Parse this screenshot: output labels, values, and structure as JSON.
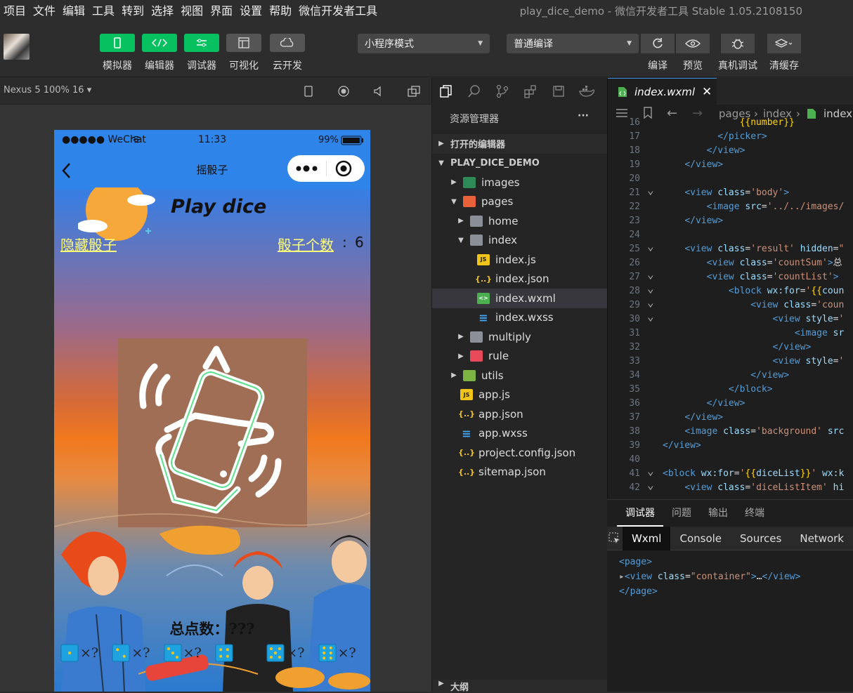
{
  "menu": [
    "项目",
    "文件",
    "编辑",
    "工具",
    "转到",
    "选择",
    "视图",
    "界面",
    "设置",
    "帮助",
    "微信开发者工具"
  ],
  "window_title": "play_dice_demo - 微信开发者工具 Stable 1.05.2108150",
  "toolbar": {
    "buttons": [
      "模拟器",
      "编辑器",
      "调试器",
      "可视化",
      "云开发"
    ],
    "mode_select": "小程序模式",
    "compile_select": "普通编译",
    "right_buttons": [
      "编译",
      "预览",
      "真机调试",
      "清缓存"
    ]
  },
  "simulator": {
    "device": "Nexus 5 100% 16 ▾",
    "status": {
      "carrier": "●●●●● WeChat",
      "time": "11:33",
      "battery": "99%"
    },
    "nav_title": "摇骰子",
    "app": {
      "title": "Play dice",
      "hide_link": "隐藏骰子",
      "count_link": "骰子个数",
      "count_sep": ":",
      "count_value": "6",
      "total": "总点数：???",
      "dice": [
        "×?",
        "×?",
        "×?",
        "×?",
        "×?",
        "×?"
      ]
    }
  },
  "explorer": {
    "title": "资源管理器",
    "more": "···",
    "sections": {
      "open_editors": "打开的编辑器",
      "project": "PLAY_DICE_DEMO",
      "outline": "大纲"
    },
    "tree": [
      {
        "label": "images",
        "depth": 1,
        "arrow": "▶",
        "kind": "folder-img"
      },
      {
        "label": "pages",
        "depth": 1,
        "arrow": "▼",
        "kind": "folder-pages"
      },
      {
        "label": "home",
        "depth": 2,
        "arrow": "▶",
        "kind": "folder"
      },
      {
        "label": "index",
        "depth": 2,
        "arrow": "▼",
        "kind": "folder-open"
      },
      {
        "label": "index.js",
        "depth": 3,
        "arrow": "",
        "kind": "js"
      },
      {
        "label": "index.json",
        "depth": 3,
        "arrow": "",
        "kind": "json"
      },
      {
        "label": "index.wxml",
        "depth": 3,
        "arrow": "",
        "kind": "wxml"
      },
      {
        "label": "index.wxss",
        "depth": 3,
        "arrow": "",
        "kind": "wxss"
      },
      {
        "label": "multiply",
        "depth": 2,
        "arrow": "▶",
        "kind": "folder"
      },
      {
        "label": "rule",
        "depth": 2,
        "arrow": "▶",
        "kind": "folder-rule"
      },
      {
        "label": "utils",
        "depth": 1,
        "arrow": "▶",
        "kind": "folder-utils"
      },
      {
        "label": "app.js",
        "depth": 1,
        "arrow": "",
        "kind": "js"
      },
      {
        "label": "app.json",
        "depth": 1,
        "arrow": "",
        "kind": "json"
      },
      {
        "label": "app.wxss",
        "depth": 1,
        "arrow": "",
        "kind": "wxss"
      },
      {
        "label": "project.config.json",
        "depth": 1,
        "arrow": "",
        "kind": "json"
      },
      {
        "label": "sitemap.json",
        "depth": 1,
        "arrow": "",
        "kind": "json"
      }
    ]
  },
  "editor": {
    "tab": "index.wxml",
    "breadcrumb": [
      "pages",
      "index",
      "index."
    ],
    "lines": [
      {
        "n": "16",
        "fold": "",
        "html": "              <span class='br'>{{number}}</span>"
      },
      {
        "n": "17",
        "fold": "",
        "html": "          <span class='tg'>&lt;/picker&gt;</span>"
      },
      {
        "n": "18",
        "fold": "",
        "html": "        <span class='tg'>&lt;/view&gt;</span>"
      },
      {
        "n": "19",
        "fold": "",
        "html": "    <span class='tg'>&lt;/view&gt;</span>"
      },
      {
        "n": "20",
        "fold": "",
        "html": ""
      },
      {
        "n": "21",
        "fold": "v",
        "html": "    <span class='tg'>&lt;view</span> <span class='at'>class</span>=<span class='st'>'body'</span><span class='tg'>&gt;</span>"
      },
      {
        "n": "22",
        "fold": "",
        "html": "        <span class='tg'>&lt;image</span> <span class='at'>src</span>=<span class='st'>'../../images/</span>"
      },
      {
        "n": "23",
        "fold": "",
        "html": "    <span class='tg'>&lt;/view&gt;</span>"
      },
      {
        "n": "24",
        "fold": "",
        "html": ""
      },
      {
        "n": "25",
        "fold": "v",
        "html": "    <span class='tg'>&lt;view</span> <span class='at'>class</span>=<span class='st'>'result'</span> <span class='at'>hidden</span>=<span class='st'>\"</span>"
      },
      {
        "n": "26",
        "fold": "",
        "html": "        <span class='tg'>&lt;view</span> <span class='at'>class</span>=<span class='st'>'countSum'</span><span class='tg'>&gt;</span>总"
      },
      {
        "n": "27",
        "fold": "v",
        "html": "        <span class='tg'>&lt;view</span> <span class='at'>class</span>=<span class='st'>'countList'</span><span class='tg'>&gt;</span>"
      },
      {
        "n": "28",
        "fold": "v",
        "html": "            <span class='tg'>&lt;block</span> <span class='at'>wx:for</span>=<span class='st'>'</span><span class='br'>{{</span><span class='at'>coun</span>"
      },
      {
        "n": "29",
        "fold": "v",
        "html": "                <span class='tg'>&lt;view</span> <span class='at'>class</span>=<span class='st'>'coun</span>"
      },
      {
        "n": "30",
        "fold": "v",
        "html": "                    <span class='tg'>&lt;view</span> <span class='at'>style</span>=<span class='st'>'</span>"
      },
      {
        "n": "31",
        "fold": "",
        "html": "                        <span class='tg'>&lt;image</span> <span class='at'>sr</span>"
      },
      {
        "n": "32",
        "fold": "",
        "html": "                    <span class='tg'>&lt;/view&gt;</span>"
      },
      {
        "n": "33",
        "fold": "",
        "html": "                    <span class='tg'>&lt;view</span> <span class='at'>style</span>=<span class='st'>'</span>"
      },
      {
        "n": "34",
        "fold": "",
        "html": "                <span class='tg'>&lt;/view&gt;</span>"
      },
      {
        "n": "35",
        "fold": "",
        "html": "            <span class='tg'>&lt;/block&gt;</span>"
      },
      {
        "n": "36",
        "fold": "",
        "html": "        <span class='tg'>&lt;/view&gt;</span>"
      },
      {
        "n": "37",
        "fold": "",
        "html": "    <span class='tg'>&lt;/view&gt;</span>"
      },
      {
        "n": "38",
        "fold": "",
        "html": "    <span class='tg'>&lt;image</span> <span class='at'>class</span>=<span class='st'>'background'</span> <span class='at'>src</span>"
      },
      {
        "n": "39",
        "fold": "",
        "html": "<span class='tg'>&lt;/view&gt;</span>"
      },
      {
        "n": "40",
        "fold": "",
        "html": ""
      },
      {
        "n": "41",
        "fold": "v",
        "html": "<span class='tg'>&lt;block</span> <span class='at'>wx:for</span>=<span class='st'>'</span><span class='br'>{{</span><span class='at'>diceList</span><span class='br'>}}</span><span class='st'>'</span> <span class='at'>wx:k</span>"
      },
      {
        "n": "42",
        "fold": "v",
        "html": "    <span class='tg'>&lt;view</span> <span class='at'>class</span>=<span class='st'>'diceListItem'</span> <span class='at'>hi</span>"
      }
    ]
  },
  "debugger": {
    "tabs": [
      "调试器",
      "问题",
      "输出",
      "终端"
    ],
    "panel_tabs": [
      "Wxml",
      "Console",
      "Sources",
      "Network"
    ],
    "dom_lines": [
      "<span class='tg'>&lt;page&gt;</span>",
      "<span style='color:#aaa'>▸</span><span class='tg'>&lt;view</span> <span class='at'>class</span>=<span class='st'>\"container\"</span><span class='tg'>&gt;</span>…<span class='tg'>&lt;/view&gt;</span>",
      "<span class='tg'>&lt;/page&gt;</span>"
    ]
  }
}
